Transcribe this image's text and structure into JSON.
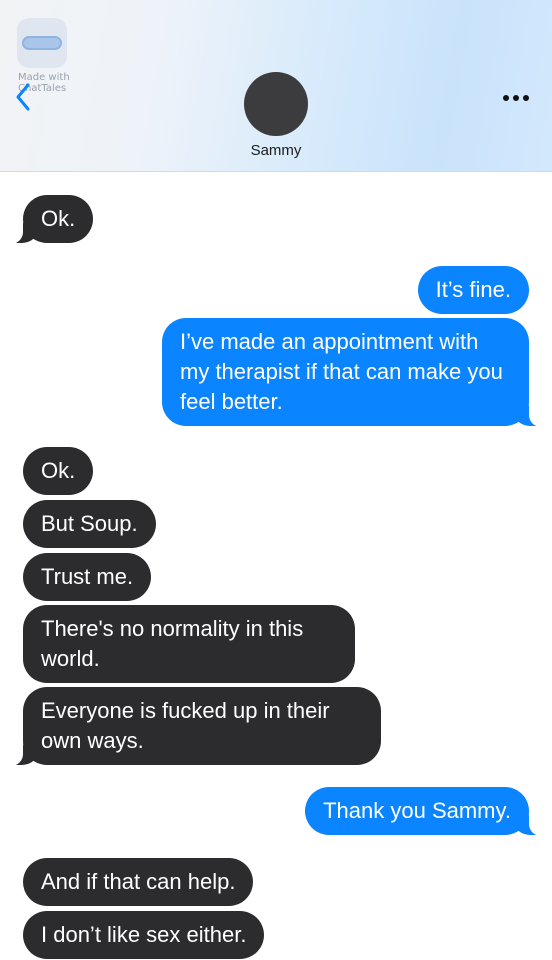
{
  "watermark": {
    "line1": "Made with",
    "line2": "ChatTales"
  },
  "contact": {
    "name": "Sammy"
  },
  "icons": {
    "back": "chevron-left-icon",
    "more": "ellipsis-icon"
  },
  "colors": {
    "outgoing": "#0a84ff",
    "incoming": "#2c2c2e",
    "accent": "#0a84ff"
  },
  "messages": [
    {
      "from": "Sammy",
      "direction": "incoming",
      "text": "Ok."
    },
    {
      "from": "me",
      "direction": "outgoing",
      "text": "It’s fine."
    },
    {
      "from": "me",
      "direction": "outgoing",
      "text": "I’ve made an appointment with my therapist if that can make you feel better."
    },
    {
      "from": "Sammy",
      "direction": "incoming",
      "text": "Ok."
    },
    {
      "from": "Sammy",
      "direction": "incoming",
      "text": "But Soup."
    },
    {
      "from": "Sammy",
      "direction": "incoming",
      "text": "Trust me."
    },
    {
      "from": "Sammy",
      "direction": "incoming",
      "text": "There's no normality in this world."
    },
    {
      "from": "Sammy",
      "direction": "incoming",
      "text": "Everyone is fucked up in their own ways."
    },
    {
      "from": "me",
      "direction": "outgoing",
      "text": "Thank you Sammy."
    },
    {
      "from": "Sammy",
      "direction": "incoming",
      "text": "And if that can help."
    },
    {
      "from": "Sammy",
      "direction": "incoming",
      "text": "I don’t like sex either."
    }
  ]
}
